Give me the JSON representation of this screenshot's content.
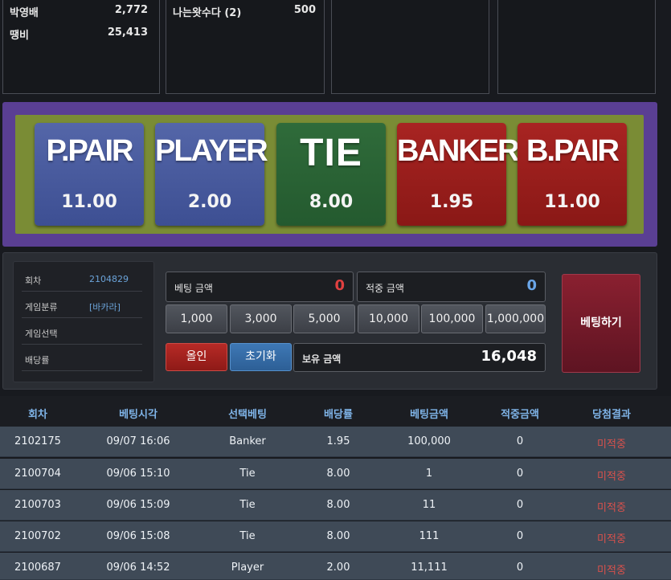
{
  "ranking": [
    [
      {
        "name": "박영배",
        "score": "2,772"
      },
      {
        "name": "땡비",
        "score": "25,413"
      }
    ],
    [
      {
        "name": "나는왓수다 (2)",
        "score": "500"
      }
    ],
    [],
    []
  ],
  "board": {
    "bets": [
      {
        "name": "P.PAIR",
        "odds": "11.00",
        "color": "#4a5aa0"
      },
      {
        "name": "PLAYER",
        "odds": "2.00",
        "color": "#4a5aa0"
      },
      {
        "name": "TIE",
        "odds": "8.00",
        "color": "#2a6535"
      },
      {
        "name": "BANKER",
        "odds": "1.95",
        "color": "#9a1e1c"
      },
      {
        "name": "B.PAIR",
        "odds": "11.00",
        "color": "#9a1e1c"
      }
    ]
  },
  "info": {
    "rows": [
      {
        "label": "회차",
        "value": "2104829"
      },
      {
        "label": "게임분류",
        "value": "[바카라]"
      },
      {
        "label": "게임선택",
        "value": ""
      },
      {
        "label": "배당률",
        "value": ""
      }
    ]
  },
  "betting": {
    "bet_amount_label": "베팅 금액",
    "bet_amount_value": "0",
    "win_amount_label": "적중 금액",
    "win_amount_value": "0",
    "chips": [
      "1,000",
      "3,000",
      "5,000",
      "10,000",
      "100,000",
      "1,000,000"
    ],
    "allin_label": "올인",
    "reset_label": "초기화",
    "balance_label": "보유 금액",
    "balance_value": "16,048",
    "place_bet_label": "베팅하기",
    "bet_color": "#e04040",
    "win_color": "#6aa6e8"
  },
  "history": {
    "headers": [
      "회차",
      "베팅시각",
      "선택베팅",
      "배당률",
      "베팅금액",
      "적중금액",
      "당첨결과"
    ],
    "rows": [
      [
        "2102175",
        "09/07 16:06",
        "Banker",
        "1.95",
        "100,000",
        "0",
        "미적중"
      ],
      [
        "2100704",
        "09/06 15:10",
        "Tie",
        "8.00",
        "1",
        "0",
        "미적중"
      ],
      [
        "2100703",
        "09/06 15:09",
        "Tie",
        "8.00",
        "11",
        "0",
        "미적중"
      ],
      [
        "2100702",
        "09/06 15:08",
        "Tie",
        "8.00",
        "111",
        "0",
        "미적중"
      ],
      [
        "2100687",
        "09/06 14:52",
        "Player",
        "2.00",
        "11,111",
        "0",
        "미적중"
      ]
    ]
  }
}
